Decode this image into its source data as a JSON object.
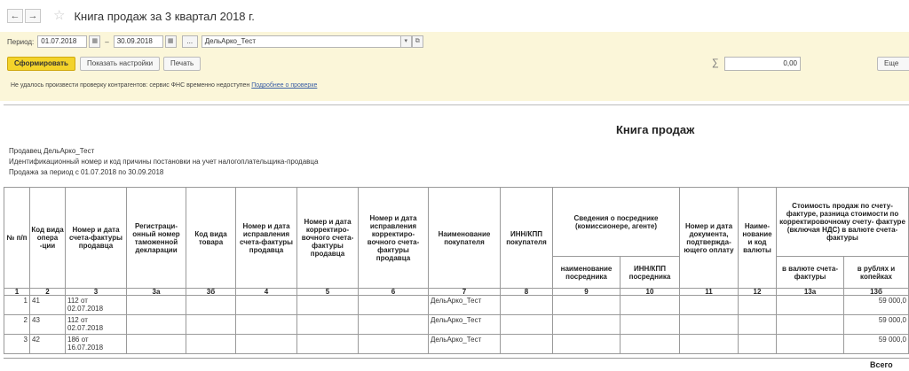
{
  "window": {
    "title": "Книга продаж за 3 квартал 2018 г.",
    "back_icon": "←",
    "forward_icon": "→",
    "star_icon": "☆"
  },
  "filters": {
    "period_label": "Период:",
    "date_from": "01.07.2018",
    "date_to": "30.09.2018",
    "dash": "–",
    "dots": "...",
    "organization": "ДельАрко_Тест"
  },
  "toolbar": {
    "generate_label": "Сформировать",
    "settings_label": "Показать настройки",
    "print_label": "Печать",
    "sum_symbol": "∑",
    "sum_value": "0,00",
    "more_label": "Еще"
  },
  "warning": {
    "text": "Не удалось произвести проверку контрагентов: сервис ФНС временно недоступен",
    "link": "Подробнее о проверке"
  },
  "report": {
    "title": "Книга продаж",
    "seller": "Продавец  ДельАрко_Тест",
    "inn_line": "Идентификационный номер и код причины постановки на учет налогоплательщика-продавца",
    "period_line": "Продажа за период с 01.07.2018 по 30.09.2018",
    "headers": {
      "n": "№ п/п",
      "code": "Код вида опера -ции",
      "number": "Номер и дата счета-фактуры продавца",
      "reg": "Регистраци- онный номер таможенной декларации",
      "goods": "Код вида товара",
      "corr": "Номер и дата исправления счета-фактуры продавца",
      "adj": "Номер и дата корректиро- вочного счета-фактуры продавца",
      "adjcorr": "Номер и дата исправления корректиро- вочного счета-фактуры продавца",
      "buyer": "Наименование покупателя",
      "inn": "ИНН/КПП покупателя",
      "broker": "Сведения о посреднике (комиссионере, агенте)",
      "broker_name": "наименование посредника",
      "broker_inn": "ИНН/КПП посредника",
      "payment": "Номер и дата документа, подтвержда- ющего оплату",
      "currency": "Наиме- нование и код валюты",
      "cost": "Стоимость продаж по счету- фактуре, разница стоимости по корректировочному счету- фактуре (включая НДС) в валюте счета-фактуры",
      "cost_cur": "в валюте счета-фактуры",
      "cost_rub": "в рублях и копейках"
    },
    "col_numbers": [
      "1",
      "2",
      "3",
      "3а",
      "3б",
      "4",
      "5",
      "6",
      "7",
      "8",
      "9",
      "10",
      "11",
      "12",
      "13а",
      "13б"
    ],
    "rows": [
      {
        "n": "1",
        "code": "41",
        "number": "112 от 02.07.2018",
        "buyer": "ДельАрко_Тест",
        "rub": "59 000,0"
      },
      {
        "n": "2",
        "code": "43",
        "number": "112 от 02.07.2018",
        "buyer": "ДельАрко_Тест",
        "rub": "59 000,0"
      },
      {
        "n": "3",
        "code": "42",
        "number": "186 от 16.07.2018",
        "buyer": "ДельАрко_Тест",
        "rub": "59 000,0"
      }
    ],
    "total_label": "Всего"
  }
}
